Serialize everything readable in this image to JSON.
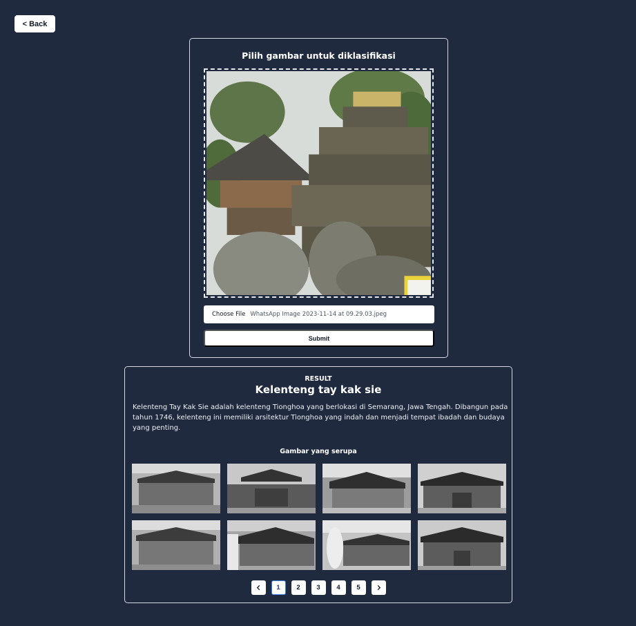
{
  "nav": {
    "back_label": "< Back"
  },
  "upload": {
    "title": "Pilih gambar untuk diklasifikasi",
    "choose_label": "Choose File",
    "file_name": "WhatsApp Image 2023-11-14 at 09.29.03.jpeg",
    "submit_label": "Submit"
  },
  "result": {
    "label": "RESULT",
    "title": "Kelenteng tay kak sie",
    "description": "Kelenteng Tay Kak Sie adalah kelenteng Tionghoa yang berlokasi di Semarang, Jawa Tengah. Dibangun pada tahun 1746, kelenteng ini memiliki arsitektur Tionghoa yang indah dan menjadi tempat ibadah dan budaya yang penting.",
    "similar_title": "Gambar yang serupa"
  },
  "pagination": {
    "pages": [
      "1",
      "2",
      "3",
      "4",
      "5"
    ],
    "current": "1",
    "prev_icon": "chevron-left-icon",
    "next_icon": "chevron-right-icon"
  },
  "colors": {
    "background": "#1f2a3f",
    "card_border": "#d5d9e2",
    "active_page": "#3b82f6"
  }
}
